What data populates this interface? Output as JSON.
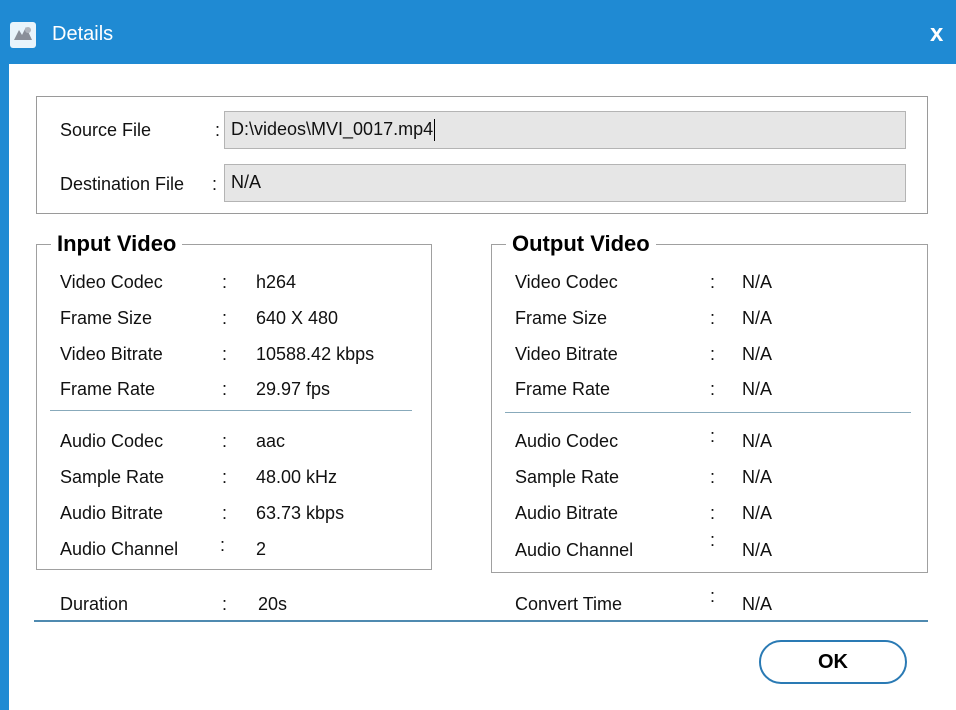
{
  "window": {
    "title": "Details",
    "close_label": "x"
  },
  "file": {
    "source_label": "Source File",
    "destination_label": "Destination File",
    "colon": ":",
    "source_value": "D:\\videos\\MVI_0017.mp4",
    "destination_value": "N/A"
  },
  "input_video": {
    "title": "Input Video",
    "rows": [
      {
        "label": "Video Codec",
        "value": "h264"
      },
      {
        "label": "Frame Size",
        "value": "640 X 480"
      },
      {
        "label": "Video Bitrate",
        "value": "10588.42 kbps"
      },
      {
        "label": "Frame Rate",
        "value": "29.97 fps"
      },
      {
        "label": "Audio Codec",
        "value": "aac"
      },
      {
        "label": "Sample Rate",
        "value": "48.00 kHz"
      },
      {
        "label": "Audio Bitrate",
        "value": "63.73 kbps"
      },
      {
        "label": "Audio Channel",
        "value": "2"
      }
    ]
  },
  "output_video": {
    "title": "Output Video",
    "rows": [
      {
        "label": "Video Codec",
        "value": "N/A"
      },
      {
        "label": "Frame Size",
        "value": "N/A"
      },
      {
        "label": "Video Bitrate",
        "value": "N/A"
      },
      {
        "label": "Frame Rate",
        "value": "N/A"
      },
      {
        "label": "Audio Codec",
        "value": "N/A"
      },
      {
        "label": "Sample Rate",
        "value": "N/A"
      },
      {
        "label": "Audio Bitrate",
        "value": "N/A"
      },
      {
        "label": "Audio Channel",
        "value": "N/A"
      }
    ]
  },
  "summary": {
    "duration_label": "Duration",
    "duration_value": "20s",
    "convert_time_label": "Convert Time",
    "convert_time_value": "N/A"
  },
  "buttons": {
    "ok_label": "OK"
  },
  "colors": {
    "titlebar": "#1f8ad3",
    "separator": "#88aabb",
    "button_border": "#2a7ab4"
  },
  "icons": {
    "app_icon": "details-app-icon",
    "close": "close-icon"
  }
}
